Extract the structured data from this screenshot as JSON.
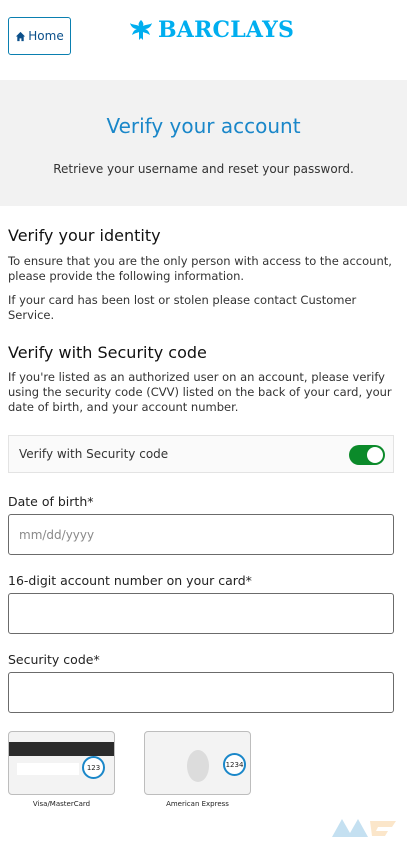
{
  "header": {
    "home_label": "Home",
    "logo_text": "BARCLAYS"
  },
  "banner": {
    "title": "Verify your account",
    "subtitle": "Retrieve your username and reset your password."
  },
  "identity": {
    "heading": "Verify your identity",
    "para1": "To ensure that you are the only person with access to the account, please provide the following information.",
    "para2": "If your card has been lost or stolen please contact Customer Service."
  },
  "security": {
    "heading": "Verify with Security code",
    "para": "If you're listed as an authorized user on an account, please verify using the security code (CVV) listed on the back of your card, your date of birth, and your account number.",
    "toggle_label": "Verify with Security code",
    "toggle_on": true
  },
  "form": {
    "dob_label": "Date of birth*",
    "dob_placeholder": "mm/dd/yyyy",
    "dob_value": "",
    "account_label": "16-digit account number on your card*",
    "account_value": "",
    "code_label": "Security code*",
    "code_value": ""
  },
  "cards": [
    {
      "caption": "Visa/MasterCard",
      "cvv": "123"
    },
    {
      "caption": "American Express",
      "cvv": "1234"
    }
  ],
  "colors": {
    "brand": "#00aeef",
    "title": "#1a87c9",
    "toggle": "#0b8a2a"
  }
}
